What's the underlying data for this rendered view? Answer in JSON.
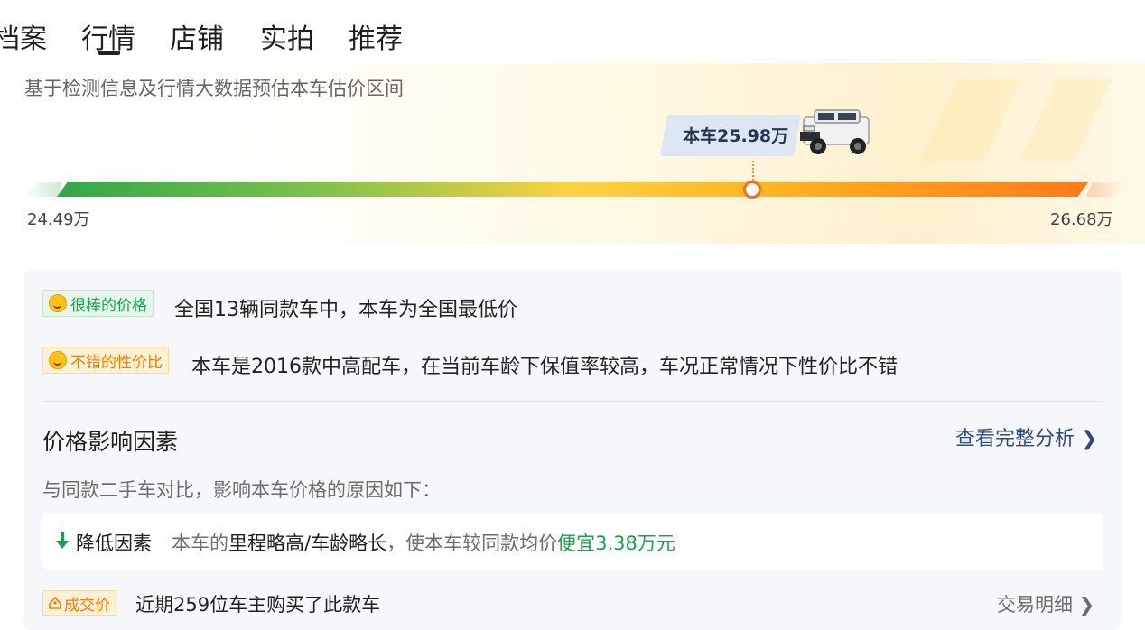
{
  "tabs": [
    {
      "label": "档案"
    },
    {
      "label": "行情",
      "active": true
    },
    {
      "label": "店铺"
    },
    {
      "label": "实拍"
    },
    {
      "label": "推荐"
    }
  ],
  "estimate": {
    "description": "基于检测信息及行情大数据预估本车估价区间",
    "car_price_label": "本车25.98万",
    "min_price": "24.49万",
    "max_price": "26.68万",
    "car_price_value": 25.98,
    "range": [
      24.49,
      26.68
    ]
  },
  "ratings": [
    {
      "badge": "很棒的价格",
      "icon": "grin-face-icon",
      "color": "#16a34a",
      "text": "全国13辆同款车中，本车为全国最低价"
    },
    {
      "badge": "不错的性价比",
      "icon": "smile-face-icon",
      "color": "#f07e00",
      "text": "本车是2016款中高配车，在当前车龄下保值率较高，车况正常情况下性价比不错"
    }
  ],
  "factors": {
    "title": "价格影响因素",
    "link": "查看完整分析 ❯",
    "subtitle": "与同款二手车对比，影响本车价格的原因如下：",
    "item": {
      "label": "降低因素",
      "desc_prefix": "本车的",
      "desc_strong": "里程略高/车龄略长",
      "desc_middle": "，使本车较同款均价",
      "desc_highlight": "便宜3.38万元"
    }
  },
  "deal": {
    "badge": "成交价",
    "text": "近期259位车主购买了此款车",
    "link": "交易明细 ❯"
  },
  "colors": {
    "bar_green": "#2fa84a",
    "bar_yellow": "#ffd23f",
    "bar_orange": "#ff7a18",
    "link_blue": "#2a4a8a",
    "good_green": "#16a34a",
    "deal_orange": "#f07e00"
  }
}
